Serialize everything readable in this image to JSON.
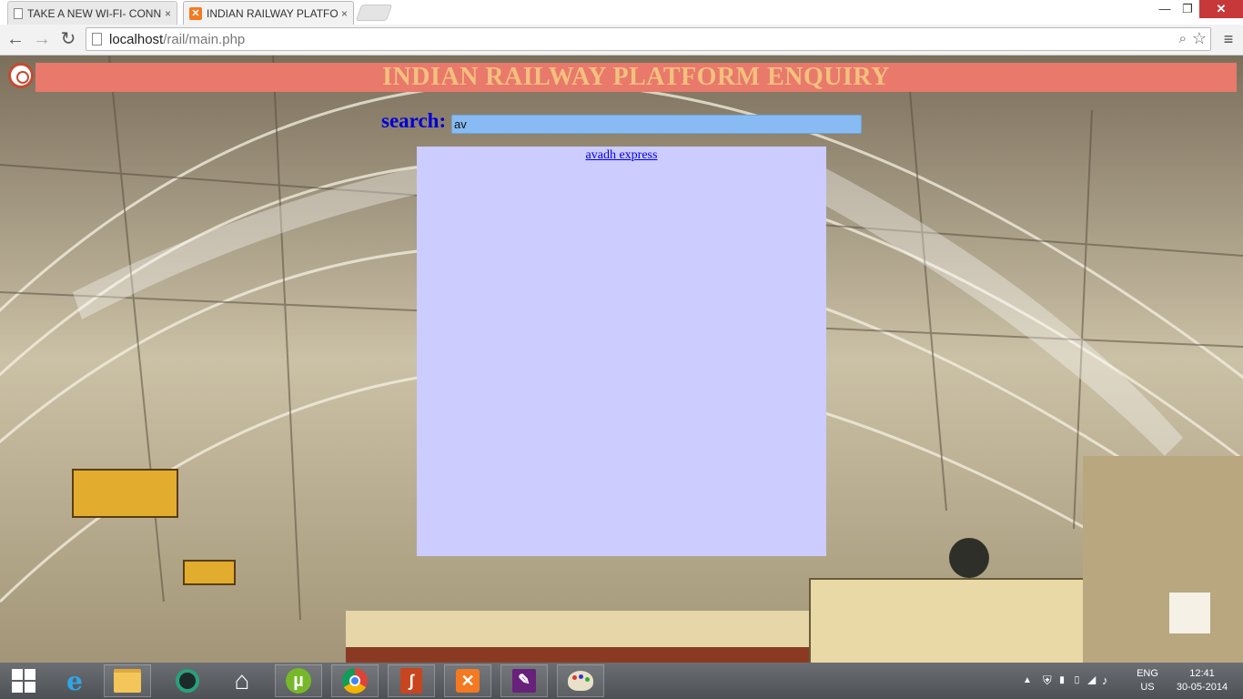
{
  "browser": {
    "tabs": [
      {
        "title": "TAKE A NEW WI-FI- CONN",
        "active": false
      },
      {
        "title": "INDIAN RAILWAY PLATFO",
        "active": true
      }
    ],
    "tab_close_glyph": "×",
    "url_host": "localhost",
    "url_path": "/rail/main.php"
  },
  "window_controls": {
    "minimize": "—",
    "maximize": "❐",
    "close": "✕"
  },
  "page": {
    "banner_title": "INDIAN RAILWAY PLATFORM ENQUIRY",
    "search_label": "search:",
    "search_value": "av",
    "results": [
      "avadh express"
    ]
  },
  "taskbar": {
    "language": "ENG",
    "region": "US",
    "time": "12:41",
    "date": "30-05-2014"
  },
  "colors": {
    "banner_bg": "#e8796b",
    "banner_text": "#f3c07e",
    "search_label": "#0000d9",
    "search_input_bg": "#88bbf3",
    "results_bg": "#ccccff",
    "link": "#0000ee"
  }
}
